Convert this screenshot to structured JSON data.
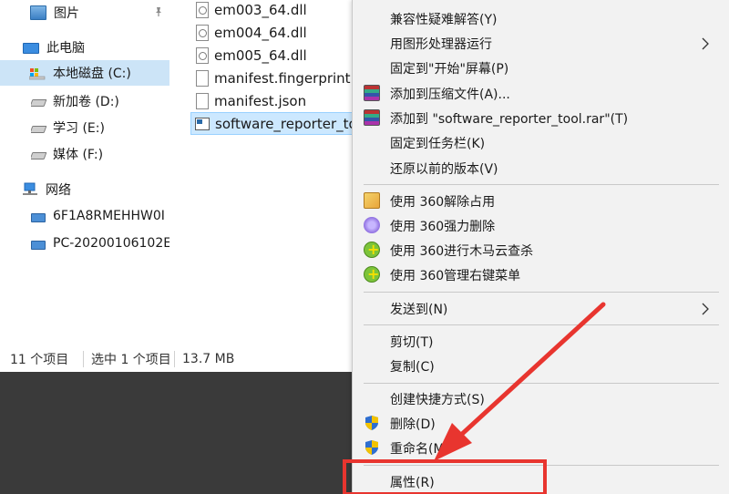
{
  "nav": {
    "items": [
      {
        "label": "图片",
        "icon": "pictures-icon"
      },
      {
        "label": "此电脑",
        "icon": "this-pc-icon"
      },
      {
        "label": "本地磁盘 (C:)",
        "icon": "drive-c-icon"
      },
      {
        "label": "新加卷 (D:)",
        "icon": "drive-icon"
      },
      {
        "label": "学习 (E:)",
        "icon": "drive-icon"
      },
      {
        "label": "媒体 (F:)",
        "icon": "drive-icon"
      },
      {
        "label": "网络",
        "icon": "network-icon"
      },
      {
        "label": "6F1A8RMEHHW0I",
        "icon": "network-pc-icon"
      },
      {
        "label": "PC-20200106102E",
        "icon": "network-pc-icon"
      }
    ]
  },
  "files": [
    {
      "name": "em003_64.dll",
      "type": "dll"
    },
    {
      "name": "em004_64.dll",
      "type": "dll"
    },
    {
      "name": "em005_64.dll",
      "type": "dll"
    },
    {
      "name": "manifest.fingerprint",
      "type": "file"
    },
    {
      "name": "manifest.json",
      "type": "file"
    },
    {
      "name": "software_reporter_tool.exe",
      "type": "exe"
    }
  ],
  "status": {
    "count": "11 个项目",
    "selected": "选中 1 个项目",
    "size": "13.7 MB"
  },
  "menu": {
    "items": [
      {
        "label": "兼容性疑难解答(Y)"
      },
      {
        "label": "用图形处理器运行",
        "submenu": true
      },
      {
        "label": "固定到\"开始\"屏幕(P)"
      },
      {
        "label": "添加到压缩文件(A)...",
        "icon": "winrar-icon"
      },
      {
        "label": "添加到 \"software_reporter_tool.rar\"(T)",
        "icon": "winrar-icon"
      },
      {
        "label": "固定到任务栏(K)"
      },
      {
        "label": "还原以前的版本(V)"
      },
      {
        "label": "使用 360解除占用",
        "icon": "360-unlock-icon"
      },
      {
        "label": "使用 360强力删除",
        "icon": "360-delete-icon"
      },
      {
        "label": "使用 360进行木马云查杀",
        "icon": "360-scan-icon"
      },
      {
        "label": "使用 360管理右键菜单",
        "icon": "360-menu-icon"
      },
      {
        "label": "发送到(N)",
        "submenu": true
      },
      {
        "label": "剪切(T)"
      },
      {
        "label": "复制(C)"
      },
      {
        "label": "创建快捷方式(S)"
      },
      {
        "label": "删除(D)",
        "icon": "shield-icon"
      },
      {
        "label": "重命名(M)",
        "icon": "shield-icon"
      },
      {
        "label": "属性(R)"
      }
    ]
  },
  "colors": {
    "annotation": "#e8352f",
    "selection": "#cce8ff",
    "menu_bg": "#f2f2f2"
  }
}
